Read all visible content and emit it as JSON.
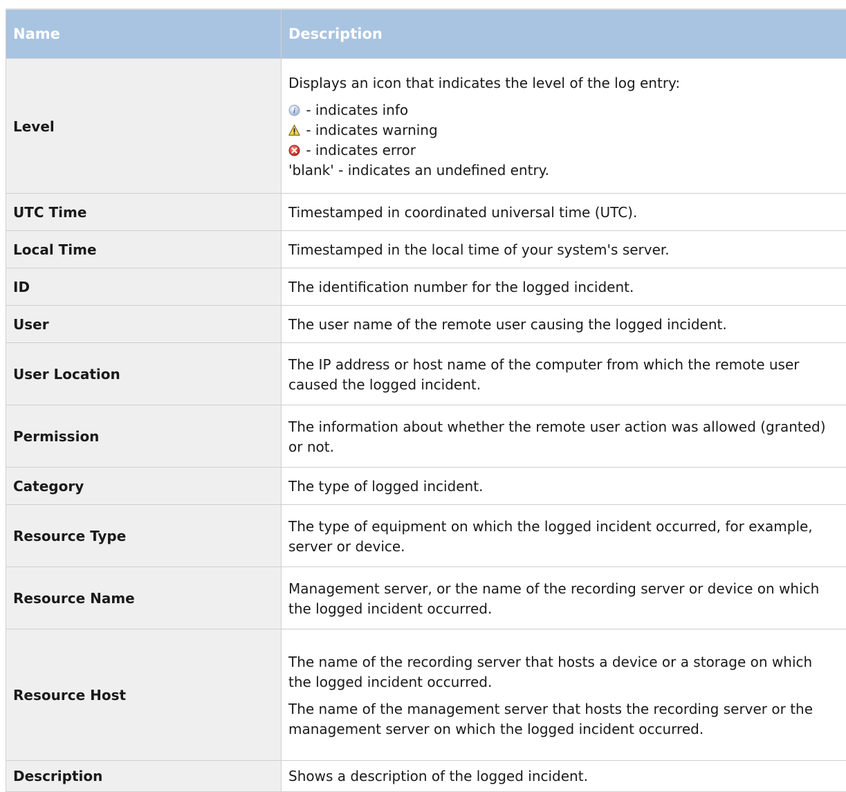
{
  "table": {
    "header": {
      "name": "Name",
      "description": "Description"
    },
    "level": {
      "name": "Level",
      "intro": "Displays an icon that indicates the level of the log entry:",
      "info": " - indicates info",
      "warning": " - indicates warning",
      "error": " - indicates error",
      "blank": "'blank' - indicates an undefined entry.",
      "icons": {
        "info": "info-icon",
        "warning": "warning-icon",
        "error": "error-icon"
      }
    },
    "rows": [
      {
        "name": "UTC Time",
        "desc": [
          "Timestamped in coordinated universal time (UTC)."
        ]
      },
      {
        "name": "Local Time",
        "desc": [
          "Timestamped in the local time of your system's server."
        ]
      },
      {
        "name": "ID",
        "desc": [
          "The identification number for the logged incident."
        ]
      },
      {
        "name": "User",
        "desc": [
          "The user name of the remote user causing the logged incident."
        ]
      },
      {
        "name": "User Location",
        "desc": [
          "The IP address or host name of the computer from which the remote user caused the logged incident."
        ]
      },
      {
        "name": "Permission",
        "desc": [
          "The information about whether the remote user action was allowed (granted) or not."
        ]
      },
      {
        "name": "Category",
        "desc": [
          "The type of logged incident."
        ]
      },
      {
        "name": "Resource Type",
        "desc": [
          "The type of equipment on which the logged incident occurred, for example, server or device."
        ]
      },
      {
        "name": "Resource Name",
        "desc": [
          "Management server, or the name of the recording server or device on which the logged incident occurred."
        ]
      },
      {
        "name": "Resource Host",
        "desc": [
          "The name of the recording server that hosts a device or a storage on which the logged incident occurred.",
          "The name of the management server that hosts the recording server or the management server on which the logged incident occurred."
        ]
      },
      {
        "name": "Description",
        "desc": [
          "Shows a description of the logged incident."
        ]
      }
    ]
  },
  "colors": {
    "header_bg": "#a9c4e0",
    "name_cell_bg": "#efefef",
    "border": "#cfcfcf"
  }
}
